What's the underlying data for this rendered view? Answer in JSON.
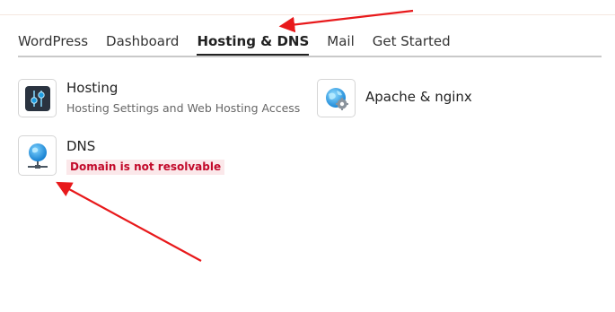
{
  "tabs": [
    {
      "label": "WordPress"
    },
    {
      "label": "Dashboard"
    },
    {
      "label": "Hosting & DNS",
      "active": true
    },
    {
      "label": "Mail"
    },
    {
      "label": "Get Started"
    }
  ],
  "tiles": {
    "hosting": {
      "title": "Hosting",
      "description": "Hosting Settings and Web Hosting Access",
      "icon": "sliders-icon"
    },
    "apache": {
      "title": "Apache & nginx",
      "icon": "globe-gear-icon"
    },
    "dns": {
      "title": "DNS",
      "status": "Domain is not resolvable",
      "icon": "globe-network-icon"
    }
  },
  "colors": {
    "tab_underline": "#222222",
    "error_text": "#c2092a",
    "error_bg": "#fbe8ea",
    "annotation_arrow": "#e8191b"
  }
}
